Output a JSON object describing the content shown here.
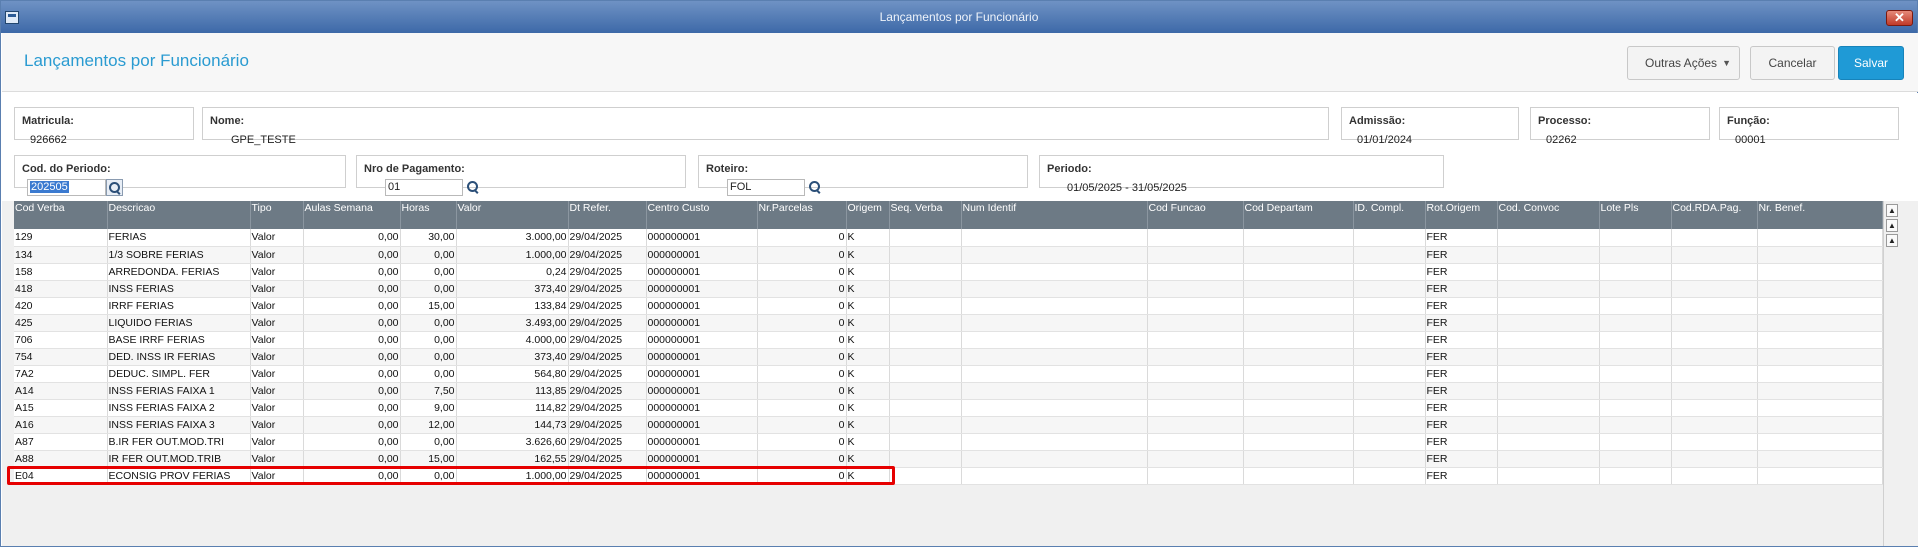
{
  "window": {
    "title": "Lançamentos por Funcionário"
  },
  "header": {
    "title": "Lançamentos por Funcionário",
    "outras_acoes": "Outras Ações",
    "cancelar": "Cancelar",
    "salvar": "Salvar"
  },
  "form": {
    "matricula": {
      "label": "Matricula:",
      "value": "926662"
    },
    "nome": {
      "label": "Nome:",
      "value": "GPE_TESTE"
    },
    "admissao": {
      "label": "Admissão:",
      "value": "01/01/2024"
    },
    "processo": {
      "label": "Processo:",
      "value": "02262"
    },
    "funcao": {
      "label": "Função:",
      "value": "00001"
    },
    "cod_periodo": {
      "label": "Cod. do Periodo:",
      "value": "202505"
    },
    "nro_pagamento": {
      "label": "Nro de Pagamento:",
      "value": "01"
    },
    "roteiro": {
      "label": "Roteiro:",
      "value": "FOL"
    },
    "periodo": {
      "label": "Periodo:",
      "value": "01/05/2025 - 31/05/2025"
    }
  },
  "grid": {
    "columns": [
      "Cod Verba",
      "Descricao",
      "Tipo",
      "Aulas Semana",
      "Horas",
      "Valor",
      "Dt Refer.",
      "Centro Custo",
      "Nr.Parcelas",
      "Origem",
      "Seq. Verba",
      "Num Identif",
      "Cod Funcao",
      "Cod Departam",
      "ID. Compl.",
      "Rot.Origem",
      "Cod. Convoc",
      "Lote Pls",
      "Cod.RDA.Pag.",
      "Nr. Benef."
    ],
    "rows": [
      [
        "129",
        "FERIAS",
        "Valor",
        "0,00",
        "30,00",
        "3.000,00",
        "29/04/2025",
        "000000001",
        "0",
        "K",
        "",
        "",
        "",
        "",
        "",
        "FER",
        "",
        "",
        "",
        ""
      ],
      [
        "134",
        "1/3 SOBRE FERIAS",
        "Valor",
        "0,00",
        "0,00",
        "1.000,00",
        "29/04/2025",
        "000000001",
        "0",
        "K",
        "",
        "",
        "",
        "",
        "",
        "FER",
        "",
        "",
        "",
        ""
      ],
      [
        "158",
        "ARREDONDA. FERIAS",
        "Valor",
        "0,00",
        "0,00",
        "0,24",
        "29/04/2025",
        "000000001",
        "0",
        "K",
        "",
        "",
        "",
        "",
        "",
        "FER",
        "",
        "",
        "",
        ""
      ],
      [
        "418",
        "INSS FERIAS",
        "Valor",
        "0,00",
        "0,00",
        "373,40",
        "29/04/2025",
        "000000001",
        "0",
        "K",
        "",
        "",
        "",
        "",
        "",
        "FER",
        "",
        "",
        "",
        ""
      ],
      [
        "420",
        "IRRF FERIAS",
        "Valor",
        "0,00",
        "15,00",
        "133,84",
        "29/04/2025",
        "000000001",
        "0",
        "K",
        "",
        "",
        "",
        "",
        "",
        "FER",
        "",
        "",
        "",
        ""
      ],
      [
        "425",
        "LIQUIDO FERIAS",
        "Valor",
        "0,00",
        "0,00",
        "3.493,00",
        "29/04/2025",
        "000000001",
        "0",
        "K",
        "",
        "",
        "",
        "",
        "",
        "FER",
        "",
        "",
        "",
        ""
      ],
      [
        "706",
        "BASE IRRF FERIAS",
        "Valor",
        "0,00",
        "0,00",
        "4.000,00",
        "29/04/2025",
        "000000001",
        "0",
        "K",
        "",
        "",
        "",
        "",
        "",
        "FER",
        "",
        "",
        "",
        ""
      ],
      [
        "754",
        "DED. INSS IR FERIAS",
        "Valor",
        "0,00",
        "0,00",
        "373,40",
        "29/04/2025",
        "000000001",
        "0",
        "K",
        "",
        "",
        "",
        "",
        "",
        "FER",
        "",
        "",
        "",
        ""
      ],
      [
        "7A2",
        "DEDUC. SIMPL. FER",
        "Valor",
        "0,00",
        "0,00",
        "564,80",
        "29/04/2025",
        "000000001",
        "0",
        "K",
        "",
        "",
        "",
        "",
        "",
        "FER",
        "",
        "",
        "",
        ""
      ],
      [
        "A14",
        "INSS FERIAS FAIXA 1",
        "Valor",
        "0,00",
        "7,50",
        "113,85",
        "29/04/2025",
        "000000001",
        "0",
        "K",
        "",
        "",
        "",
        "",
        "",
        "FER",
        "",
        "",
        "",
        ""
      ],
      [
        "A15",
        "INSS FERIAS FAIXA 2",
        "Valor",
        "0,00",
        "9,00",
        "114,82",
        "29/04/2025",
        "000000001",
        "0",
        "K",
        "",
        "",
        "",
        "",
        "",
        "FER",
        "",
        "",
        "",
        ""
      ],
      [
        "A16",
        "INSS FERIAS FAIXA 3",
        "Valor",
        "0,00",
        "12,00",
        "144,73",
        "29/04/2025",
        "000000001",
        "0",
        "K",
        "",
        "",
        "",
        "",
        "",
        "FER",
        "",
        "",
        "",
        ""
      ],
      [
        "A87",
        "B.IR FER OUT.MOD.TRI",
        "Valor",
        "0,00",
        "0,00",
        "3.626,60",
        "29/04/2025",
        "000000001",
        "0",
        "K",
        "",
        "",
        "",
        "",
        "",
        "FER",
        "",
        "",
        "",
        ""
      ],
      [
        "A88",
        "IR FER OUT.MOD.TRIB",
        "Valor",
        "0,00",
        "15,00",
        "162,55",
        "29/04/2025",
        "000000001",
        "0",
        "K",
        "",
        "",
        "",
        "",
        "",
        "FER",
        "",
        "",
        "",
        ""
      ],
      [
        "E04",
        "ECONSIG PROV FERIAS",
        "Valor",
        "0,00",
        "0,00",
        "1.000,00",
        "29/04/2025",
        "000000001",
        "0",
        "K",
        "",
        "",
        "",
        "",
        "",
        "FER",
        "",
        "",
        "",
        ""
      ]
    ]
  },
  "colors": {
    "accent": "#1f9ad6",
    "header_bg": "#6d7a85",
    "highlight": "#e60000"
  }
}
